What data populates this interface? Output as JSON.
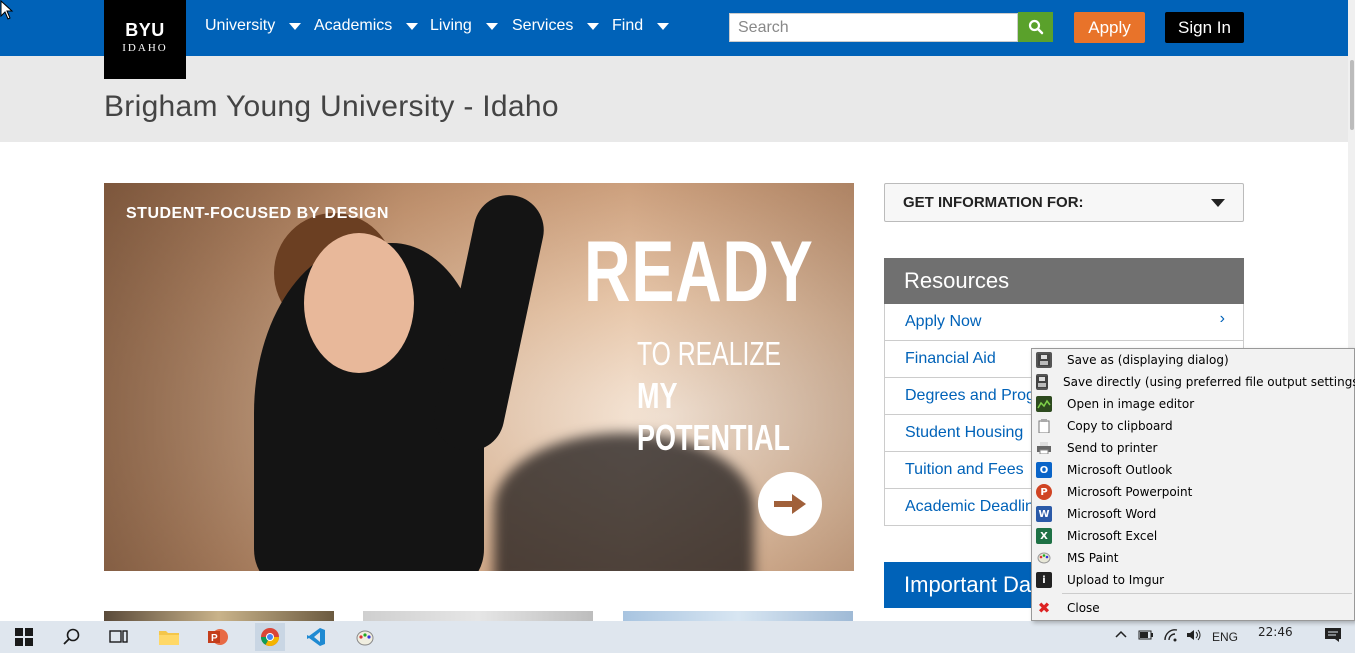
{
  "header": {
    "logo_line1": "BYU",
    "logo_line2": "IDAHO",
    "nav": [
      "University",
      "Academics",
      "Living",
      "Services",
      "Find"
    ],
    "search_placeholder": "Search",
    "apply_label": "Apply",
    "signin_label": "Sign In"
  },
  "page": {
    "title": "Brigham Young University - Idaho"
  },
  "hero": {
    "tagline": "STUDENT-FOCUSED BY DESIGN",
    "headline": "READY",
    "sub1": "TO REALIZE",
    "sub2": "MY POTENTIAL"
  },
  "sidebar": {
    "get_info_label": "GET INFORMATION FOR:",
    "resources_title": "Resources",
    "resources": [
      "Apply Now",
      "Financial Aid",
      "Degrees and Programs",
      "Student Housing",
      "Tuition and Fees",
      "Academic Deadlines"
    ],
    "important_title": "Important Dates"
  },
  "context_menu": {
    "items": [
      {
        "label": "Save as (displaying dialog)",
        "icon": "floppy-icon"
      },
      {
        "label": "Save directly (using preferred file output settings)",
        "icon": "floppy-icon"
      },
      {
        "label": "Open in image editor",
        "icon": "image-editor-icon"
      },
      {
        "label": "Copy to clipboard",
        "icon": "clipboard-icon"
      },
      {
        "label": "Send to printer",
        "icon": "printer-icon"
      },
      {
        "label": "Microsoft Outlook",
        "icon": "outlook-icon"
      },
      {
        "label": "Microsoft Powerpoint",
        "icon": "powerpoint-icon"
      },
      {
        "label": "Microsoft Word",
        "icon": "word-icon"
      },
      {
        "label": "Microsoft Excel",
        "icon": "excel-icon"
      },
      {
        "label": "MS Paint",
        "icon": "paint-icon"
      },
      {
        "label": "Upload to Imgur",
        "icon": "imgur-icon"
      },
      {
        "label": "Close",
        "icon": "close-icon"
      }
    ]
  },
  "taskbar": {
    "language": "ENG",
    "time": "22:46"
  },
  "colors": {
    "brand_blue": "#0062b8",
    "apply_orange": "#e8732a",
    "search_green": "#5aa12b"
  }
}
